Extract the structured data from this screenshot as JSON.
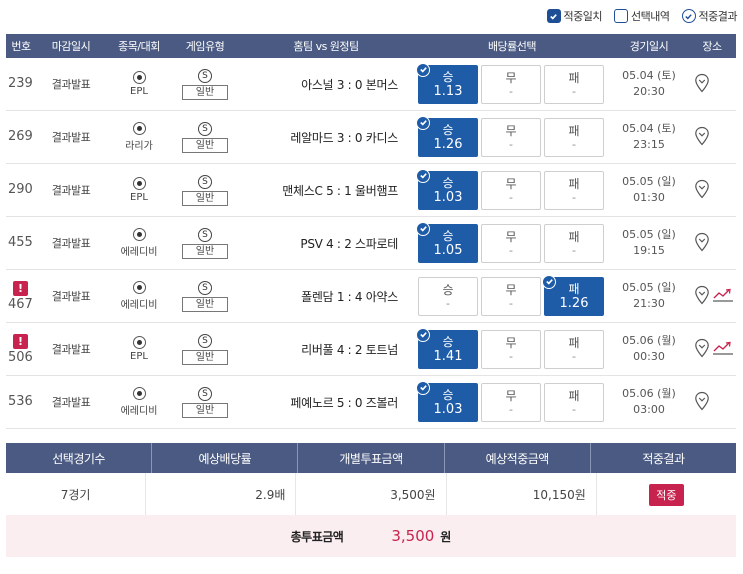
{
  "filters": [
    {
      "label": "적중일치",
      "state": "checked"
    },
    {
      "label": "선택내역",
      "state": "empty"
    },
    {
      "label": "적중결과",
      "state": "circle"
    }
  ],
  "headers": {
    "num": "번호",
    "deadline": "마감일시",
    "league": "종목/대회",
    "game_type": "게임유형",
    "match": "홈팀 vs 원정팀",
    "odds": "배당률선택",
    "date": "경기일시",
    "place": "장소"
  },
  "rows": [
    {
      "num": "239",
      "alert": false,
      "deadline": "결과발표",
      "league": "EPL",
      "type_badge": "S",
      "type": "일반",
      "match": "아스널 3 : 0 본머스",
      "odds": [
        {
          "label": "승",
          "value": "1.13",
          "sel": true
        },
        {
          "label": "무",
          "value": "-",
          "sel": false
        },
        {
          "label": "패",
          "value": "-",
          "sel": false
        }
      ],
      "date": "05.04 (토)",
      "time": "20:30",
      "trend": false
    },
    {
      "num": "269",
      "alert": false,
      "deadline": "결과발표",
      "league": "라리가",
      "type_badge": "S",
      "type": "일반",
      "match": "레알마드 3 : 0 카디스",
      "odds": [
        {
          "label": "승",
          "value": "1.26",
          "sel": true
        },
        {
          "label": "무",
          "value": "-",
          "sel": false
        },
        {
          "label": "패",
          "value": "-",
          "sel": false
        }
      ],
      "date": "05.04 (토)",
      "time": "23:15",
      "trend": false
    },
    {
      "num": "290",
      "alert": false,
      "deadline": "결과발표",
      "league": "EPL",
      "type_badge": "S",
      "type": "일반",
      "match": "맨체스C 5 : 1 울버햄프",
      "odds": [
        {
          "label": "승",
          "value": "1.03",
          "sel": true
        },
        {
          "label": "무",
          "value": "-",
          "sel": false
        },
        {
          "label": "패",
          "value": "-",
          "sel": false
        }
      ],
      "date": "05.05 (일)",
      "time": "01:30",
      "trend": false
    },
    {
      "num": "455",
      "alert": false,
      "deadline": "결과발표",
      "league": "에레디비",
      "type_badge": "S",
      "type": "일반",
      "match": "PSV 4 : 2 스파로테",
      "odds": [
        {
          "label": "승",
          "value": "1.05",
          "sel": true
        },
        {
          "label": "무",
          "value": "-",
          "sel": false
        },
        {
          "label": "패",
          "value": "-",
          "sel": false
        }
      ],
      "date": "05.05 (일)",
      "time": "19:15",
      "trend": false
    },
    {
      "num": "467",
      "alert": true,
      "deadline": "결과발표",
      "league": "에레디비",
      "type_badge": "S",
      "type": "일반",
      "match": "폴렌담 1 : 4 아약스",
      "odds": [
        {
          "label": "승",
          "value": "-",
          "sel": false
        },
        {
          "label": "무",
          "value": "-",
          "sel": false
        },
        {
          "label": "패",
          "value": "1.26",
          "sel": true
        }
      ],
      "date": "05.05 (일)",
      "time": "21:30",
      "trend": true
    },
    {
      "num": "506",
      "alert": true,
      "deadline": "결과발표",
      "league": "EPL",
      "type_badge": "S",
      "type": "일반",
      "match": "리버풀 4 : 2 토트넘",
      "odds": [
        {
          "label": "승",
          "value": "1.41",
          "sel": true
        },
        {
          "label": "무",
          "value": "-",
          "sel": false
        },
        {
          "label": "패",
          "value": "-",
          "sel": false
        }
      ],
      "date": "05.06 (월)",
      "time": "00:30",
      "trend": true
    },
    {
      "num": "536",
      "alert": false,
      "deadline": "결과발표",
      "league": "에레디비",
      "type_badge": "S",
      "type": "일반",
      "match": "페예노르 5 : 0 즈볼러",
      "odds": [
        {
          "label": "승",
          "value": "1.03",
          "sel": true
        },
        {
          "label": "무",
          "value": "-",
          "sel": false
        },
        {
          "label": "패",
          "value": "-",
          "sel": false
        }
      ],
      "date": "05.06 (월)",
      "time": "03:00",
      "trend": false
    }
  ],
  "summary": {
    "headers": [
      "선택경기수",
      "예상배당률",
      "개별투표금액",
      "예상적중금액",
      "적중결과"
    ],
    "games": "7경기",
    "odds": "2.9배",
    "bet": "3,500원",
    "expected": "10,150원",
    "result": "적중"
  },
  "total": {
    "label": "총투표금액",
    "amount": "3,500",
    "unit": "원"
  },
  "alert_glyph": "!",
  "colors": {
    "header": "#4a5a82",
    "selected": "#1e5ca8",
    "accent": "#c8234e",
    "total_bg": "#fbeef0"
  }
}
